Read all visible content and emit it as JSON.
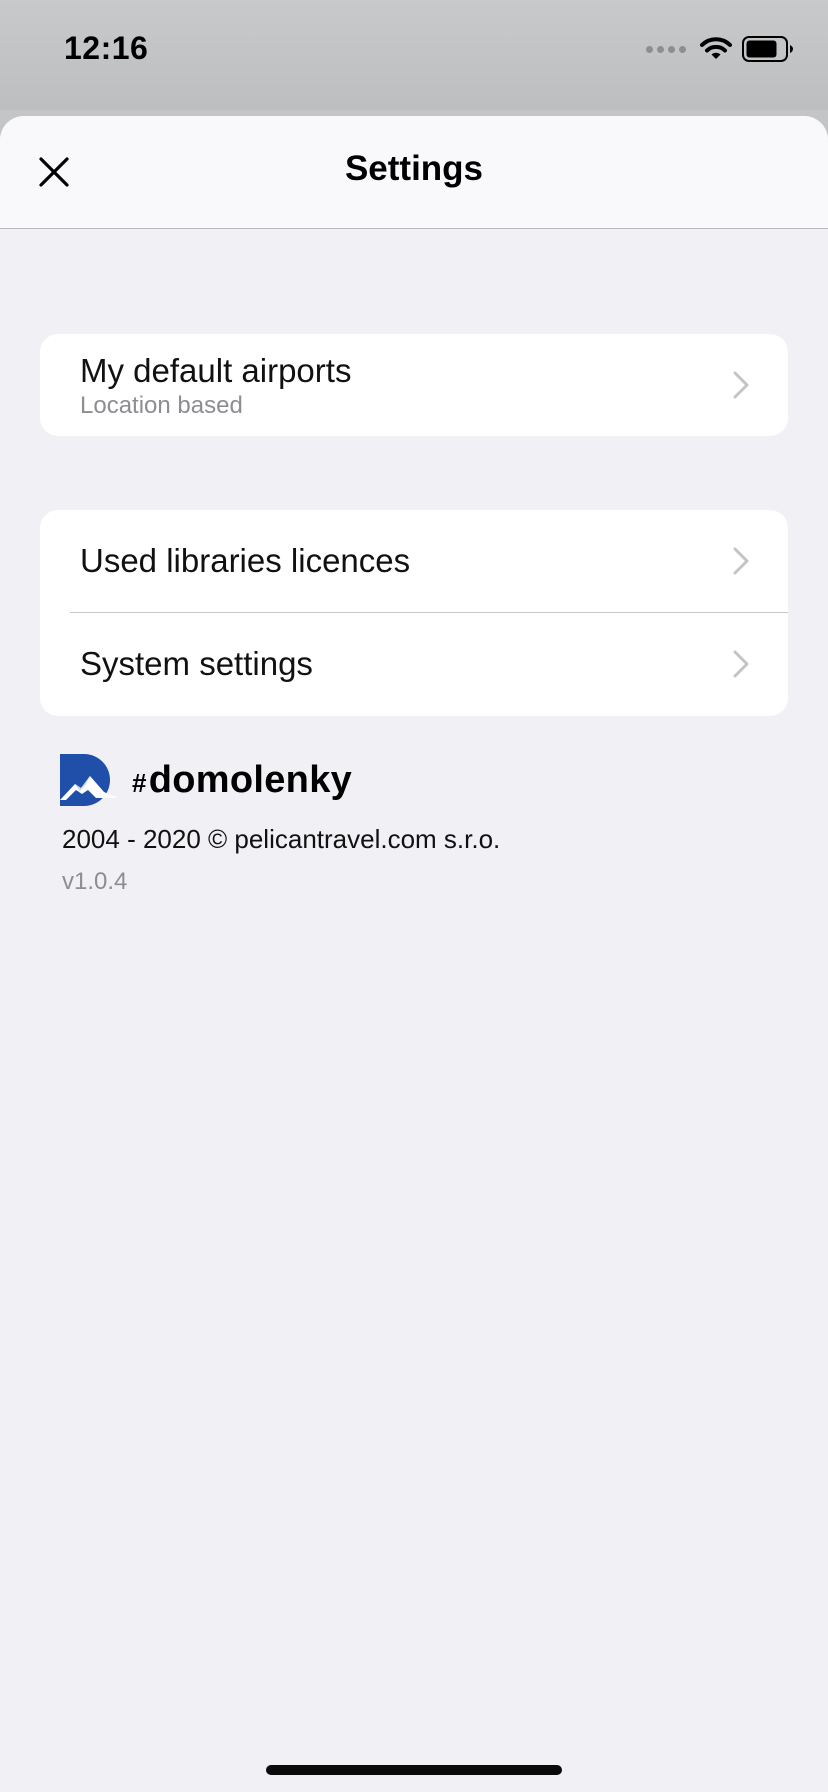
{
  "status_bar": {
    "time": "12:16",
    "icons": [
      "cellular-signal-icon",
      "wifi-icon",
      "battery-icon"
    ]
  },
  "nav": {
    "title": "Settings",
    "close_icon": "close-icon"
  },
  "sections": {
    "airports": {
      "title": "My default airports",
      "subtitle": "Location based"
    },
    "libraries": {
      "title": "Used libraries licences"
    },
    "system": {
      "title": "System settings"
    }
  },
  "footer": {
    "brand_hash": "#",
    "brand_name": "domolenky",
    "copyright": "2004 - 2020 © pelicantravel.com s.r.o.",
    "version": "v1.0.4"
  },
  "colors": {
    "background": "#f0f0f5",
    "card": "#ffffff",
    "secondary_text": "#8d8d92",
    "logo_blue": "#1f4fa8"
  }
}
